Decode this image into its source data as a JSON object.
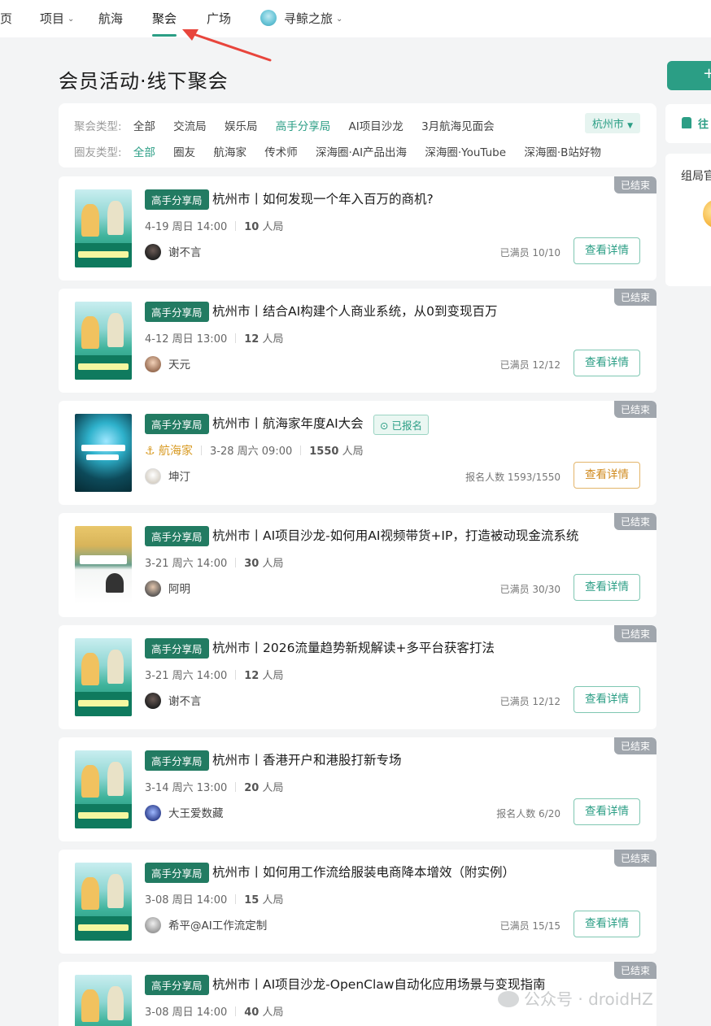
{
  "nav": {
    "items": [
      {
        "label": "页"
      },
      {
        "label": "项目"
      },
      {
        "label": "航海"
      },
      {
        "label": "聚会"
      },
      {
        "label": "广场"
      },
      {
        "label": "寻鲸之旅"
      }
    ],
    "active": "聚会"
  },
  "page": {
    "title": "会员活动·线下聚会",
    "create_button": "+"
  },
  "filters": {
    "row1_label": "聚会类型:",
    "row1_options": [
      "全部",
      "交流局",
      "娱乐局",
      "高手分享局",
      "AI项目沙龙",
      "3月航海见面会"
    ],
    "row1_active": "高手分享局",
    "row2_label": "圈友类型:",
    "row2_options": [
      "全部",
      "圈友",
      "航海家",
      "传术师",
      "深海圈·AI产品出海",
      "深海圈·YouTube",
      "深海圈·B站好物"
    ],
    "row2_active": "全部",
    "city": "杭州市"
  },
  "sidebar": {
    "card1_label": "往",
    "card2_label": "组局官"
  },
  "events": [
    {
      "status": "已结束",
      "badge": "高手分享局",
      "title": "杭州市丨如何发现一个年入百万的商机?",
      "date": "4-19 周日 14:00",
      "count": "10",
      "unit": "人局",
      "host": "谢不言",
      "stat": "已满员 10/10",
      "button": "查看详情"
    },
    {
      "status": "已结束",
      "badge": "高手分享局",
      "title": "杭州市丨结合AI构建个人商业系统，从0到变现百万",
      "date": "4-12 周日 13:00",
      "count": "12",
      "unit": "人局",
      "host": "天元",
      "stat": "已满员 12/12",
      "button": "查看详情"
    },
    {
      "status": "已结束",
      "badge": "高手分享局",
      "title": "杭州市丨航海家年度AI大会",
      "signed": "已报名",
      "tag": "航海家",
      "date": "3-28 周六 09:00",
      "count": "1550",
      "unit": "人局",
      "host": "坤汀",
      "stat": "报名人数 1593/1550",
      "button": "查看详情"
    },
    {
      "status": "已结束",
      "badge": "高手分享局",
      "title": "杭州市丨AI项目沙龙-如何用AI视频带货+IP，打造被动现金流系统",
      "date": "3-21 周六 14:00",
      "count": "30",
      "unit": "人局",
      "host": "阿明",
      "stat": "已满员 30/30",
      "button": "查看详情"
    },
    {
      "status": "已结束",
      "badge": "高手分享局",
      "title": "杭州市丨2026流量趋势新规解读+多平台获客打法",
      "date": "3-21 周六 14:00",
      "count": "12",
      "unit": "人局",
      "host": "谢不言",
      "stat": "已满员 12/12",
      "button": "查看详情"
    },
    {
      "status": "已结束",
      "badge": "高手分享局",
      "title": "杭州市丨香港开户和港股打新专场",
      "date": "3-14 周六 13:00",
      "count": "20",
      "unit": "人局",
      "host": "大王爱数藏",
      "stat": "报名人数 6/20",
      "button": "查看详情"
    },
    {
      "status": "已结束",
      "badge": "高手分享局",
      "title": "杭州市丨如何用工作流给服装电商降本增效（附实例）",
      "date": "3-08 周日 14:00",
      "count": "15",
      "unit": "人局",
      "host": "希平@AI工作流定制",
      "stat": "已满员 15/15",
      "button": "查看详情"
    },
    {
      "status": "已结束",
      "badge": "高手分享局",
      "title": "杭州市丨AI项目沙龙-OpenClaw自动化应用场景与变现指南",
      "date": "3-08 周日 14:00",
      "count": "40",
      "unit": "人局"
    }
  ],
  "watermark": "公众号 · droidHZ",
  "colors": {
    "accent": "#2b9e85",
    "badge": "#227b62",
    "ended": "#a0a6ad",
    "annotation": "#e8453c"
  }
}
